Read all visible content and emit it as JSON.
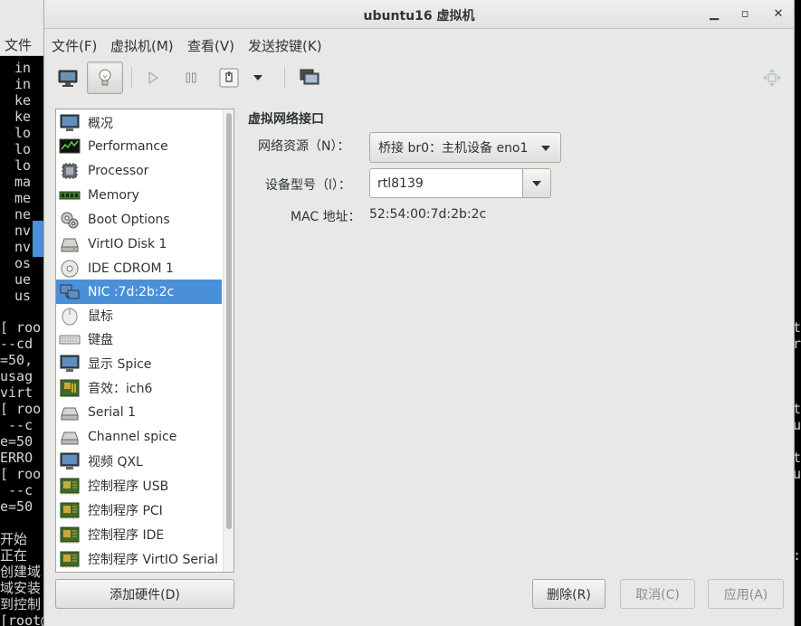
{
  "terminal": {
    "menu_label": "文件",
    "left_lines": [
      "in",
      "in",
      "ke",
      "ke",
      "lo",
      "lo",
      "lo",
      "ma",
      "me",
      "ne",
      "nv",
      "nv",
      "os",
      "ue",
      "us",
      "",
      "[ roo",
      "--cd",
      "=50,",
      "usag",
      "virt",
      "[ roo",
      " --c",
      "e=50",
      "ERRO",
      "[ roo",
      " --c",
      "e=50",
      "",
      "开始",
      "正在",
      "创建域",
      "域安装",
      "到控制",
      "[root@localhost 桌面]#"
    ],
    "right_lines": [
      "t",
      "r",
      "",
      "",
      "",
      "t",
      "u",
      "",
      "t",
      "u",
      "",
      "",
      "",
      "",
      ":",
      ""
    ]
  },
  "window": {
    "title": "ubuntu16 虚拟机",
    "minimize_glyph": "▁",
    "maximize_glyph": "▫",
    "close_glyph": "✕"
  },
  "menu": {
    "file": "文件(F)",
    "vm": "虚拟机(M)",
    "view": "查看(V)",
    "send_key": "发送按键(K)"
  },
  "toolbar": {
    "icons": [
      "monitor-icon",
      "lightbulb-icon",
      "play-icon",
      "pause-icon",
      "power-icon",
      "dropdown-icon",
      "snapshot-icon",
      "fullscreen-icon"
    ]
  },
  "hardware": {
    "items": [
      {
        "label": "概况",
        "icon": "overview-icon"
      },
      {
        "label": "Performance",
        "icon": "performance-icon"
      },
      {
        "label": "Processor",
        "icon": "processor-icon"
      },
      {
        "label": "Memory",
        "icon": "memory-icon"
      },
      {
        "label": "Boot Options",
        "icon": "boot-options-icon"
      },
      {
        "label": "VirtIO Disk 1",
        "icon": "disk-icon"
      },
      {
        "label": "IDE CDROM 1",
        "icon": "cdrom-icon"
      },
      {
        "label": "NIC :7d:2b:2c",
        "icon": "nic-icon"
      },
      {
        "label": "鼠标",
        "icon": "mouse-icon"
      },
      {
        "label": "键盘",
        "icon": "keyboard-icon"
      },
      {
        "label": "显示  Spice",
        "icon": "display-icon"
      },
      {
        "label": "音效：ich6",
        "icon": "sound-icon"
      },
      {
        "label": "Serial 1",
        "icon": "serial-icon"
      },
      {
        "label": "Channel spice",
        "icon": "channel-icon"
      },
      {
        "label": "视频  QXL",
        "icon": "video-icon"
      },
      {
        "label": "控制程序  USB",
        "icon": "controller-icon"
      },
      {
        "label": "控制程序  PCI",
        "icon": "controller-icon"
      },
      {
        "label": "控制程序  IDE",
        "icon": "controller-icon"
      },
      {
        "label": "控制程序  VirtIO Serial",
        "icon": "controller-icon"
      }
    ],
    "selected_index": 7,
    "add_button": "添加硬件(D)"
  },
  "detail": {
    "title": "虚拟网络接口",
    "network_source_label": "网络资源（N）：",
    "network_source_value": "桥接  br0：主机设备  eno1",
    "device_model_label": "设备型号（l）：",
    "device_model_value": "rtl8139",
    "mac_label": "MAC 地址：",
    "mac_value": "52:54:00:7d:2b:2c"
  },
  "buttons": {
    "remove": "删除(R)",
    "cancel": "取消(C)",
    "apply": "应用(A)"
  },
  "colors": {
    "selection": "#4a90d9",
    "window_bg": "#e8e8e7",
    "terminal_bg": "#000000"
  }
}
